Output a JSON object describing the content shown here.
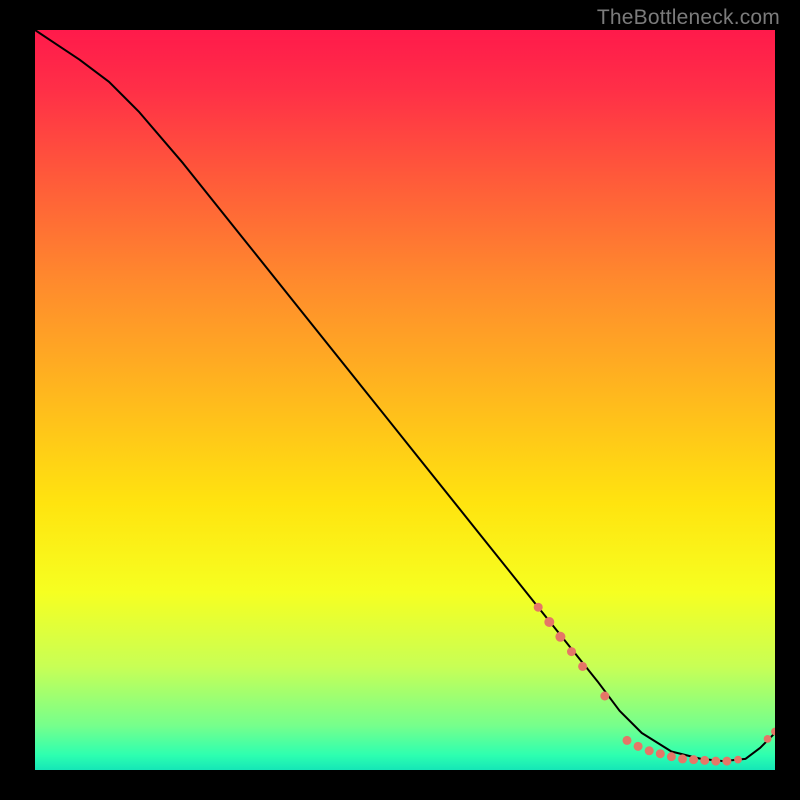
{
  "watermark": "TheBottleneck.com",
  "chart_data": {
    "type": "line",
    "title": "",
    "xlabel": "",
    "ylabel": "",
    "xlim": [
      0,
      100
    ],
    "ylim": [
      0,
      100
    ],
    "grid": false,
    "legend": null,
    "series": [
      {
        "name": "bottleneck-curve",
        "color": "#000000",
        "x": [
          0,
          3,
          6,
          10,
          14,
          20,
          28,
          36,
          44,
          52,
          60,
          68,
          72,
          76,
          79,
          82,
          86,
          90,
          93,
          96,
          98,
          100
        ],
        "y": [
          100,
          98,
          96,
          93,
          89,
          82,
          72,
          62,
          52,
          42,
          32,
          22,
          17,
          12,
          8,
          5,
          2.5,
          1.5,
          1.2,
          1.5,
          3,
          5
        ]
      }
    ],
    "markers": {
      "name": "highlighted-points",
      "color": "#e57667",
      "points": [
        {
          "x": 68,
          "y": 22,
          "r": 4.5
        },
        {
          "x": 69.5,
          "y": 20,
          "r": 5
        },
        {
          "x": 71,
          "y": 18,
          "r": 5
        },
        {
          "x": 72.5,
          "y": 16,
          "r": 4.5
        },
        {
          "x": 74,
          "y": 14,
          "r": 4.5
        },
        {
          "x": 77,
          "y": 10,
          "r": 4.5
        },
        {
          "x": 80,
          "y": 4.0,
          "r": 4.5
        },
        {
          "x": 81.5,
          "y": 3.2,
          "r": 4.5
        },
        {
          "x": 83,
          "y": 2.6,
          "r": 4.5
        },
        {
          "x": 84.5,
          "y": 2.2,
          "r": 4.5
        },
        {
          "x": 86,
          "y": 1.8,
          "r": 4.5
        },
        {
          "x": 87.5,
          "y": 1.5,
          "r": 4.5
        },
        {
          "x": 89,
          "y": 1.4,
          "r": 4.5
        },
        {
          "x": 90.5,
          "y": 1.3,
          "r": 4.5
        },
        {
          "x": 92,
          "y": 1.2,
          "r": 4.5
        },
        {
          "x": 93.5,
          "y": 1.2,
          "r": 4.5
        },
        {
          "x": 95,
          "y": 1.4,
          "r": 3.9
        },
        {
          "x": 99,
          "y": 4.2,
          "r": 3.9
        },
        {
          "x": 100,
          "y": 5.2,
          "r": 3.9
        }
      ]
    },
    "gradient_background_stops": [
      {
        "pos": 0,
        "color": "#ff1a4b"
      },
      {
        "pos": 8,
        "color": "#ff2f47"
      },
      {
        "pos": 20,
        "color": "#ff5a3a"
      },
      {
        "pos": 34,
        "color": "#ff8a2d"
      },
      {
        "pos": 48,
        "color": "#ffb41f"
      },
      {
        "pos": 64,
        "color": "#ffe40f"
      },
      {
        "pos": 76,
        "color": "#f6ff21"
      },
      {
        "pos": 86,
        "color": "#c8ff55"
      },
      {
        "pos": 94,
        "color": "#76ff8c"
      },
      {
        "pos": 98,
        "color": "#2dffb0"
      },
      {
        "pos": 100,
        "color": "#15e6b7"
      }
    ]
  }
}
